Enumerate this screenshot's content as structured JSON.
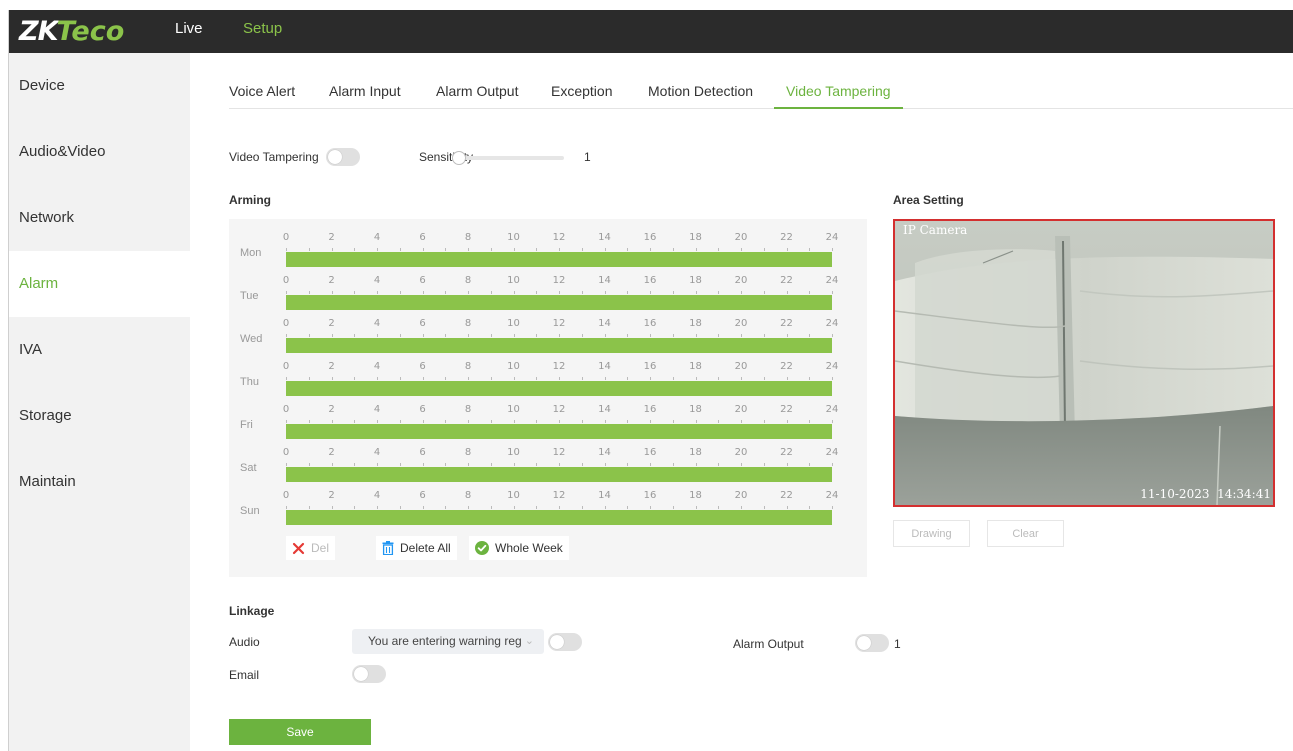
{
  "topbar": {
    "logo_main": "ZK",
    "logo_sub": "Teco",
    "nav": {
      "live": "Live",
      "setup": "Setup"
    }
  },
  "sidebar": {
    "items": [
      {
        "label": "Device"
      },
      {
        "label": "Audio&Video"
      },
      {
        "label": "Network"
      },
      {
        "label": "Alarm",
        "active": true
      },
      {
        "label": "IVA"
      },
      {
        "label": "Storage"
      },
      {
        "label": "Maintain"
      }
    ]
  },
  "tabs": [
    {
      "label": "Voice Alert"
    },
    {
      "label": "Alarm Input"
    },
    {
      "label": "Alarm Output"
    },
    {
      "label": "Exception"
    },
    {
      "label": "Motion Detection"
    },
    {
      "label": "Video Tampering",
      "active": true
    }
  ],
  "settings": {
    "video_tampering_label": "Video Tampering",
    "video_tampering_on": false,
    "sensitivity_label": "Sensitivity",
    "sensitivity_value": "1"
  },
  "arming": {
    "title": "Arming",
    "days": [
      "Mon",
      "Tue",
      "Wed",
      "Thu",
      "Fri",
      "Sat",
      "Sun"
    ],
    "hour_ticks": [
      "0",
      "2",
      "4",
      "6",
      "8",
      "10",
      "12",
      "14",
      "16",
      "18",
      "20",
      "22",
      "24"
    ],
    "schedule_fill": 1.0,
    "buttons": {
      "del": "Del",
      "delete_all": "Delete All",
      "whole_week": "Whole Week"
    }
  },
  "area_setting": {
    "title": "Area Setting",
    "camera_label": "IP Camera",
    "timestamp": "11-10-2023  14:34:41",
    "buttons": {
      "drawing": "Drawing",
      "clear": "Clear"
    }
  },
  "linkage": {
    "title": "Linkage",
    "audio_label": "Audio",
    "audio_value": "You are entering warning reg",
    "alarm_output_label": "Alarm Output",
    "alarm_output_value": "1",
    "email_label": "Email"
  },
  "save_label": "Save",
  "colors": {
    "accent": "#6cb33f",
    "bar_green": "#8bc34a",
    "topbar": "#2b2b2b",
    "area_border": "#d32f2f"
  }
}
